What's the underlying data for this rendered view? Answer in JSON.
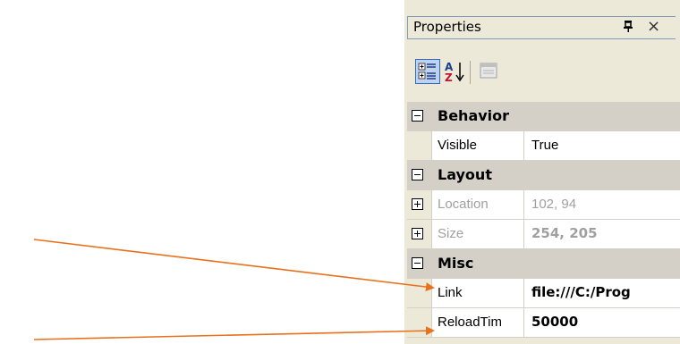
{
  "window": {
    "title": "Properties",
    "pin_glyph": "❙",
    "close_glyph": "×"
  },
  "toolbar": {
    "categorized_icon": "categorized-icon",
    "alphabetical_icon": "alphabetical-sort-icon",
    "property_pages_icon": "property-pages-icon"
  },
  "grid": {
    "behavior": {
      "label": "Behavior",
      "visible": {
        "name": "Visible",
        "value": "True"
      }
    },
    "layout": {
      "label": "Layout",
      "location": {
        "name": "Location",
        "value": "102, 94"
      },
      "size": {
        "name": "Size",
        "value": "254, 205"
      }
    },
    "misc": {
      "label": "Misc",
      "link": {
        "name": "Link",
        "value": "file:///C:/Prog"
      },
      "reloadtime": {
        "name": "ReloadTim",
        "value": "50000"
      }
    }
  },
  "colors": {
    "arrow": "#e8711c",
    "panel_bg": "#ece9d8",
    "category_bg": "#d4d0c8"
  }
}
